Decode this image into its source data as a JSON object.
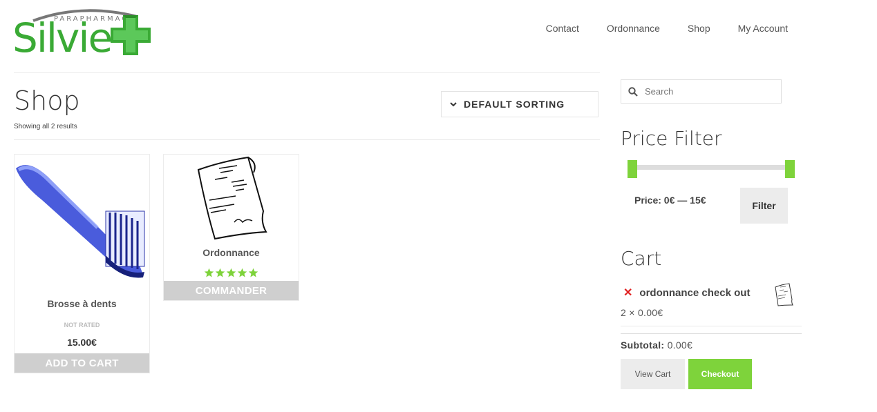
{
  "brand": {
    "sub": "PARAPHARMACIE",
    "name": "Silvie",
    "green": "#3aaa35",
    "accent": "#7ed33b"
  },
  "nav": [
    "Contact",
    "Ordonnance",
    "Shop",
    "My Account"
  ],
  "shop": {
    "title": "Shop",
    "results": "Showing all 2 results",
    "sorting": "DEFAULT SORTING",
    "products": [
      {
        "name": "Brosse à dents",
        "rating": "NOT RATED",
        "price": "15.00€",
        "button": "ADD TO CART",
        "image": "toothbrush-icon"
      },
      {
        "name": "Ordonnance",
        "stars": 5,
        "button": "COMMANDER",
        "image": "prescription-icon"
      }
    ]
  },
  "sidebar": {
    "search_placeholder": "Search",
    "price_filter_title": "Price Filter",
    "price_label": "Price: 0€ — 15€",
    "filter_button": "Filter",
    "cart_title": "Cart",
    "cart_item": "ordonnance check out",
    "cart_qty": "2 × 0.00€",
    "subtotal_label": "Subtotal:",
    "subtotal_value": "0.00€",
    "view_cart": "View Cart",
    "checkout": "Checkout"
  }
}
